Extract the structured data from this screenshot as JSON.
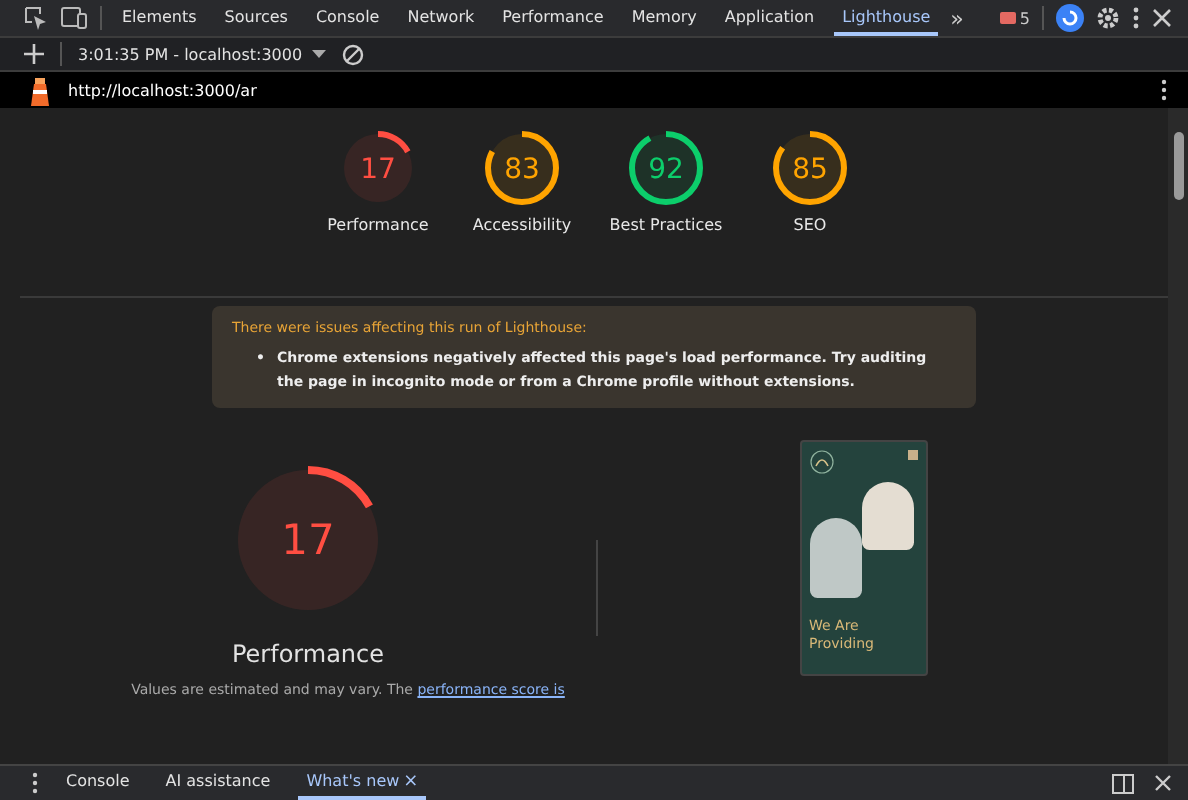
{
  "tabs": [
    {
      "label": "Elements",
      "selected": false
    },
    {
      "label": "Sources",
      "selected": false
    },
    {
      "label": "Console",
      "selected": false
    },
    {
      "label": "Network",
      "selected": false
    },
    {
      "label": "Performance",
      "selected": false
    },
    {
      "label": "Memory",
      "selected": false
    },
    {
      "label": "Application",
      "selected": false
    },
    {
      "label": "Lighthouse",
      "selected": true
    }
  ],
  "more_tabs": "»",
  "error_count": "5",
  "report_selector": "3:01:35 PM - localhost:3000",
  "url": "http://localhost:3000/ar",
  "gauges": [
    {
      "score": "17",
      "label": "Performance",
      "level": 0.17,
      "color": "#ff4e42"
    },
    {
      "score": "83",
      "label": "Accessibility",
      "level": 0.83,
      "color": "#ffa400"
    },
    {
      "score": "92",
      "label": "Best Practices",
      "level": 0.92,
      "color": "#0cce6b"
    },
    {
      "score": "85",
      "label": "SEO",
      "level": 0.85,
      "color": "#ffa400"
    }
  ],
  "warning": {
    "title": "There were issues affecting this run of Lighthouse:",
    "bullet": "•",
    "items": [
      "Chrome extensions negatively affected this page's load performance. Try auditing the page in incognito mode or from a Chrome profile without extensions."
    ]
  },
  "main_gauge": {
    "score": "17",
    "label": "Performance",
    "level": 0.17,
    "color": "#ff4e42"
  },
  "description": {
    "text": "Values are estimated and may vary. The",
    "link": "performance score is"
  },
  "preview": {
    "heading": "We Are Providing"
  },
  "drawer_tabs": [
    {
      "label": "Console",
      "selected": false,
      "closable": false
    },
    {
      "label": "AI assistance",
      "selected": false,
      "closable": false
    },
    {
      "label": "What's new",
      "selected": true,
      "closable": true
    }
  ],
  "close_glyph": "×"
}
